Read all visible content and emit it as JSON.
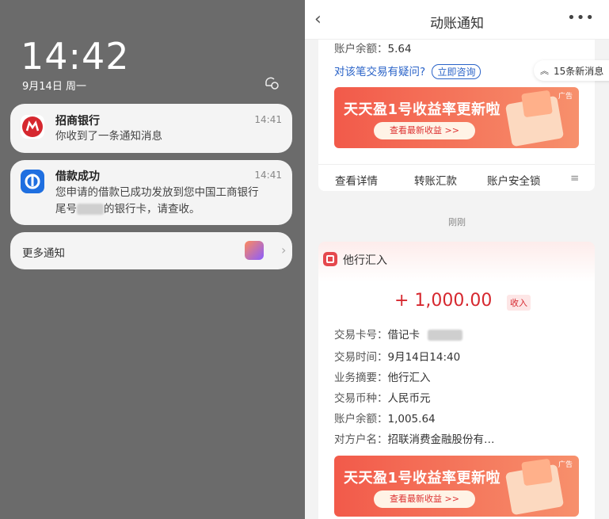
{
  "lock": {
    "time": "14:42",
    "date": "9月14日 周一",
    "notifications": [
      {
        "app": "招商银行",
        "time": "14:41",
        "body": "你收到了一条通知消息",
        "icon": "cmb-logo-icon"
      },
      {
        "app": "借款成功",
        "time": "14:41",
        "body1": "您申请的借款已成功发放到您中国工商银行",
        "body2a": "尾号",
        "body2b": "的银行卡，请查收。",
        "icon": "loan-app-icon"
      }
    ],
    "more_label": "更多通知"
  },
  "app": {
    "title": "动账通知",
    "top_card": {
      "balance_label": "账户余额：",
      "balance": "5.64",
      "question": "对该笔交易有疑问?",
      "consult": "立即咨询",
      "tabs": [
        "查看详情",
        "转账汇款",
        "账户安全锁",
        "≡"
      ]
    },
    "new_messages": "15条新消息",
    "separator_time": "刚刚",
    "banner": {
      "title": "天天盈1号收益率更新啦",
      "button": "查看最新收益 >>",
      "ad": "广告"
    },
    "txn": {
      "type": "他行汇入",
      "amount": "+ 1,000.00",
      "amount_tag": "收入",
      "rows": [
        {
          "k": "交易卡号：",
          "v": "借记卡"
        },
        {
          "k": "交易时间：",
          "v": "9月14日14:40"
        },
        {
          "k": "业务摘要：",
          "v": "他行汇入"
        },
        {
          "k": "交易币种：",
          "v": "人民币元"
        },
        {
          "k": "账户余额：",
          "v": "1,005.64"
        },
        {
          "k": "对方户名：",
          "v": "招联消费金融股份有…"
        }
      ]
    }
  }
}
